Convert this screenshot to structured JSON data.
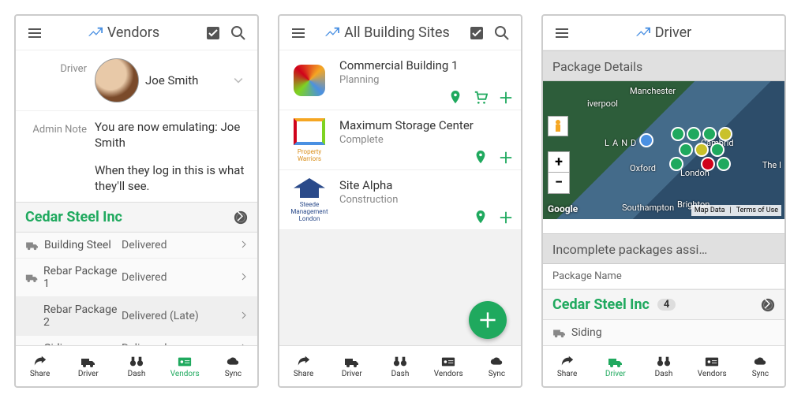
{
  "screen1": {
    "title": "Vendors",
    "driver_label": "Driver",
    "driver_name": "Joe Smith",
    "admin_label": "Admin Note",
    "admin_note_1": "You are now emulating: Joe Smith",
    "admin_note_2": "When they log in this is what they'll see.",
    "vendor_name": "Cedar Steel Inc",
    "packages": [
      {
        "name": "Building Steel",
        "status": "Delivered",
        "icon": true
      },
      {
        "name": "Rebar Package 1",
        "status": "Delivered",
        "icon": true
      },
      {
        "name": "Rebar Package 2",
        "status": "Delivered (Late)",
        "icon": false
      },
      {
        "name": "Siding",
        "status": "Delivered",
        "icon": true
      }
    ]
  },
  "screen2": {
    "title": "All Building Sites",
    "sites": [
      {
        "name": "Commercial Building 1",
        "status": "Planning",
        "logo_caption": "",
        "cart": true
      },
      {
        "name": "Maximum Storage Center",
        "status": "Complete",
        "logo_caption": "Property Warriors",
        "cart": false
      },
      {
        "name": "Site Alpha",
        "status": "Construction",
        "logo_caption": "Steede Management London",
        "cart": false
      }
    ]
  },
  "screen3": {
    "title": "Driver",
    "section1": "Package Details",
    "section2": "Incomplete packages assi…",
    "col_head": "Package Name",
    "vendor_name": "Cedar Steel Inc",
    "vendor_count": "4",
    "pkg_row": "Siding",
    "map": {
      "cities": [
        "Manchester",
        "iverpool",
        "LAND",
        "Cambrid",
        "Oxford",
        "London",
        "Brighton",
        "Southampton",
        "The I"
      ],
      "branding": "Google",
      "attrib": [
        "Map Data",
        "Terms of Use"
      ]
    }
  },
  "nav": {
    "items": [
      "Share",
      "Driver",
      "Dash",
      "Vendors",
      "Sync"
    ]
  }
}
